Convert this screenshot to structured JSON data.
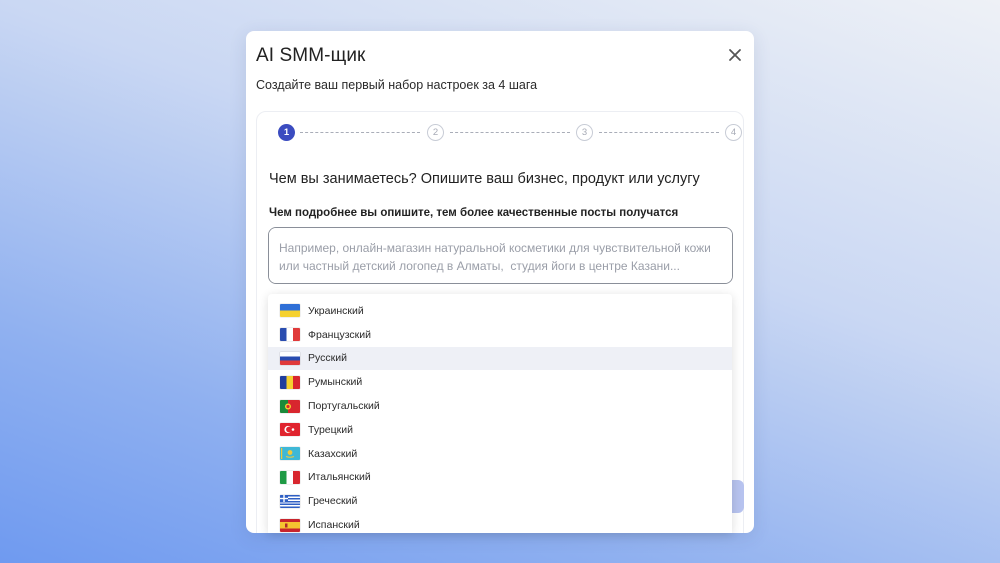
{
  "modal": {
    "title": "AI SMM-щик",
    "subtitle": "Создайте ваш первый набор настроек за 4 шага"
  },
  "stepper": {
    "current_step": 1,
    "steps": [
      "1",
      "2",
      "3",
      "4"
    ]
  },
  "form": {
    "question": "Чем вы занимаетесь? Опишите ваш бизнес, продукт или услугу",
    "hint": "Чем подробнее вы опишите, тем более качественные посты получатся",
    "textarea_placeholder": "Например, онлайн-магазин натуральной косметики для чувствительной кожи или частный детский логопед в Алматы,  студия йоги в центре Казани..."
  },
  "language_dropdown": {
    "selected": "Русский",
    "items": [
      {
        "label": "Украинский",
        "flag": "ukraine-flag-icon"
      },
      {
        "label": "Французский",
        "flag": "france-flag-icon"
      },
      {
        "label": "Русский",
        "flag": "russia-flag-icon"
      },
      {
        "label": "Румынский",
        "flag": "romania-flag-icon"
      },
      {
        "label": "Португальский",
        "flag": "portugal-flag-icon"
      },
      {
        "label": "Турецкий",
        "flag": "turkey-flag-icon"
      },
      {
        "label": "Казахский",
        "flag": "kazakhstan-flag-icon"
      },
      {
        "label": "Итальянский",
        "flag": "italy-flag-icon"
      },
      {
        "label": "Греческий",
        "flag": "greece-flag-icon"
      },
      {
        "label": "Испанский",
        "flag": "spain-flag-icon"
      }
    ]
  },
  "colors": {
    "accent": "#3b4cc0",
    "selected_row": "#eef0f6"
  }
}
